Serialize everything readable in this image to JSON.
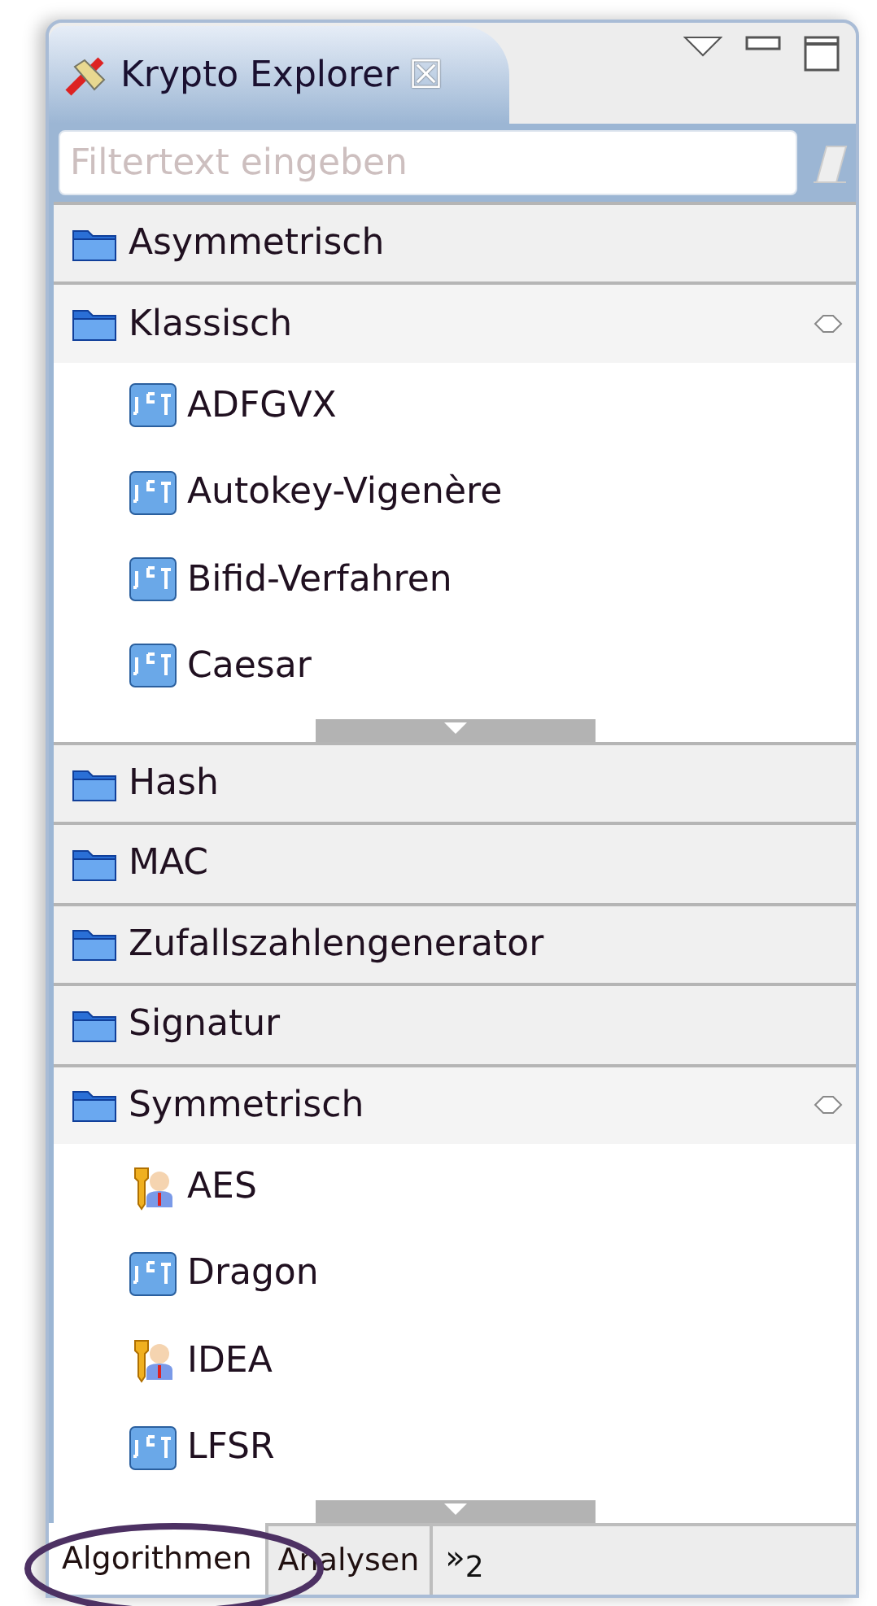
{
  "view": {
    "title": "Krypto Explorer",
    "close_glyph": "☒"
  },
  "filter": {
    "placeholder": "Filtertext eingeben"
  },
  "groups": [
    {
      "label": "Asymmetrisch",
      "expanded": false
    },
    {
      "label": "Klassisch",
      "expanded": true,
      "items": [
        {
          "label": "ADFGVX",
          "kind": "jct"
        },
        {
          "label": "Autokey-Vigenère",
          "kind": "jct"
        },
        {
          "label": "Bifid-Verfahren",
          "kind": "jct"
        },
        {
          "label": "Caesar",
          "kind": "jct"
        }
      ]
    },
    {
      "label": "Hash",
      "expanded": false
    },
    {
      "label": "MAC",
      "expanded": false
    },
    {
      "label": "Zufallszahlengenerator",
      "expanded": false
    },
    {
      "label": "Signatur",
      "expanded": false
    },
    {
      "label": "Symmetrisch",
      "expanded": true,
      "items": [
        {
          "label": "AES",
          "kind": "key"
        },
        {
          "label": "Dragon",
          "kind": "jct"
        },
        {
          "label": "IDEA",
          "kind": "key"
        },
        {
          "label": "LFSR",
          "kind": "jct"
        }
      ]
    }
  ],
  "tabs": [
    {
      "label": "Algorithmen",
      "selected": true
    },
    {
      "label": "Analysen",
      "selected": false
    }
  ],
  "overflow": {
    "glyph": "»",
    "count": "2"
  }
}
